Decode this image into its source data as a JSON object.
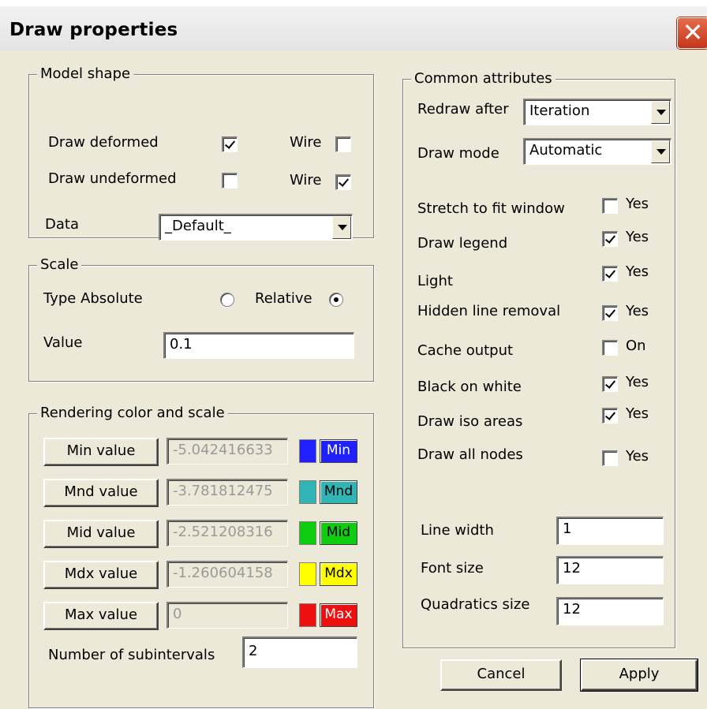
{
  "window": {
    "title": "Draw properties",
    "close_glyph": "✕"
  },
  "model_shape": {
    "legend": "Model shape",
    "draw_deformed": {
      "label": "Draw deformed",
      "checked": true,
      "wire_label": "Wire",
      "wire_checked": false
    },
    "draw_undeformed": {
      "label": "Draw undeformed",
      "checked": false,
      "wire_label": "Wire",
      "wire_checked": true
    },
    "data": {
      "label": "Data",
      "value": "_Default_"
    }
  },
  "scale": {
    "legend": "Scale",
    "type_label": "Type Absolute",
    "relative_label": "Relative",
    "selected": "relative",
    "value_label": "Value",
    "value": "0.1"
  },
  "rendering": {
    "legend": "Rendering color and scale",
    "rows": [
      {
        "button": "Min value",
        "value": "-5.042416633",
        "color": "#2020ff",
        "color_label": "Min"
      },
      {
        "button": "Mnd value",
        "value": "-3.781812475",
        "color": "#30b4b4",
        "color_label": "Mnd"
      },
      {
        "button": "Mid value",
        "value": "-2.521208316",
        "color": "#10cc10",
        "color_label": "Mid"
      },
      {
        "button": "Mdx value",
        "value": "-1.260604158",
        "color": "#ffff00",
        "color_label": "Mdx"
      },
      {
        "button": "Max value",
        "value": "0",
        "color": "#ee1010",
        "color_label": "Max"
      }
    ],
    "subintervals_label": "Number of subintervals",
    "subintervals_value": "2"
  },
  "common": {
    "legend": "Common attributes",
    "redraw_after": {
      "label": "Redraw after",
      "value": "Iteration"
    },
    "draw_mode": {
      "label": "Draw mode",
      "value": "Automatic"
    },
    "options": [
      {
        "label": "Stretch to fit window",
        "checked": false,
        "text": "Yes"
      },
      {
        "label": "Draw legend",
        "checked": true,
        "text": "Yes"
      },
      {
        "label": "Light",
        "checked": true,
        "text": "Yes"
      },
      {
        "label": "Hidden line removal",
        "checked": true,
        "text": "Yes"
      },
      {
        "label": "Cache output",
        "checked": false,
        "text": "On"
      },
      {
        "label": "Black on white",
        "checked": true,
        "text": "Yes"
      },
      {
        "label": "Draw iso areas",
        "checked": true,
        "text": "Yes"
      },
      {
        "label": "Draw all nodes",
        "checked": false,
        "text": "Yes"
      }
    ],
    "line_width": {
      "label": "Line width",
      "value": "1"
    },
    "font_size": {
      "label": "Font size",
      "value": "12"
    },
    "quadratics_size": {
      "label": "Quadratics size",
      "value": "12"
    }
  },
  "buttons": {
    "cancel": "Cancel",
    "apply": "Apply"
  }
}
